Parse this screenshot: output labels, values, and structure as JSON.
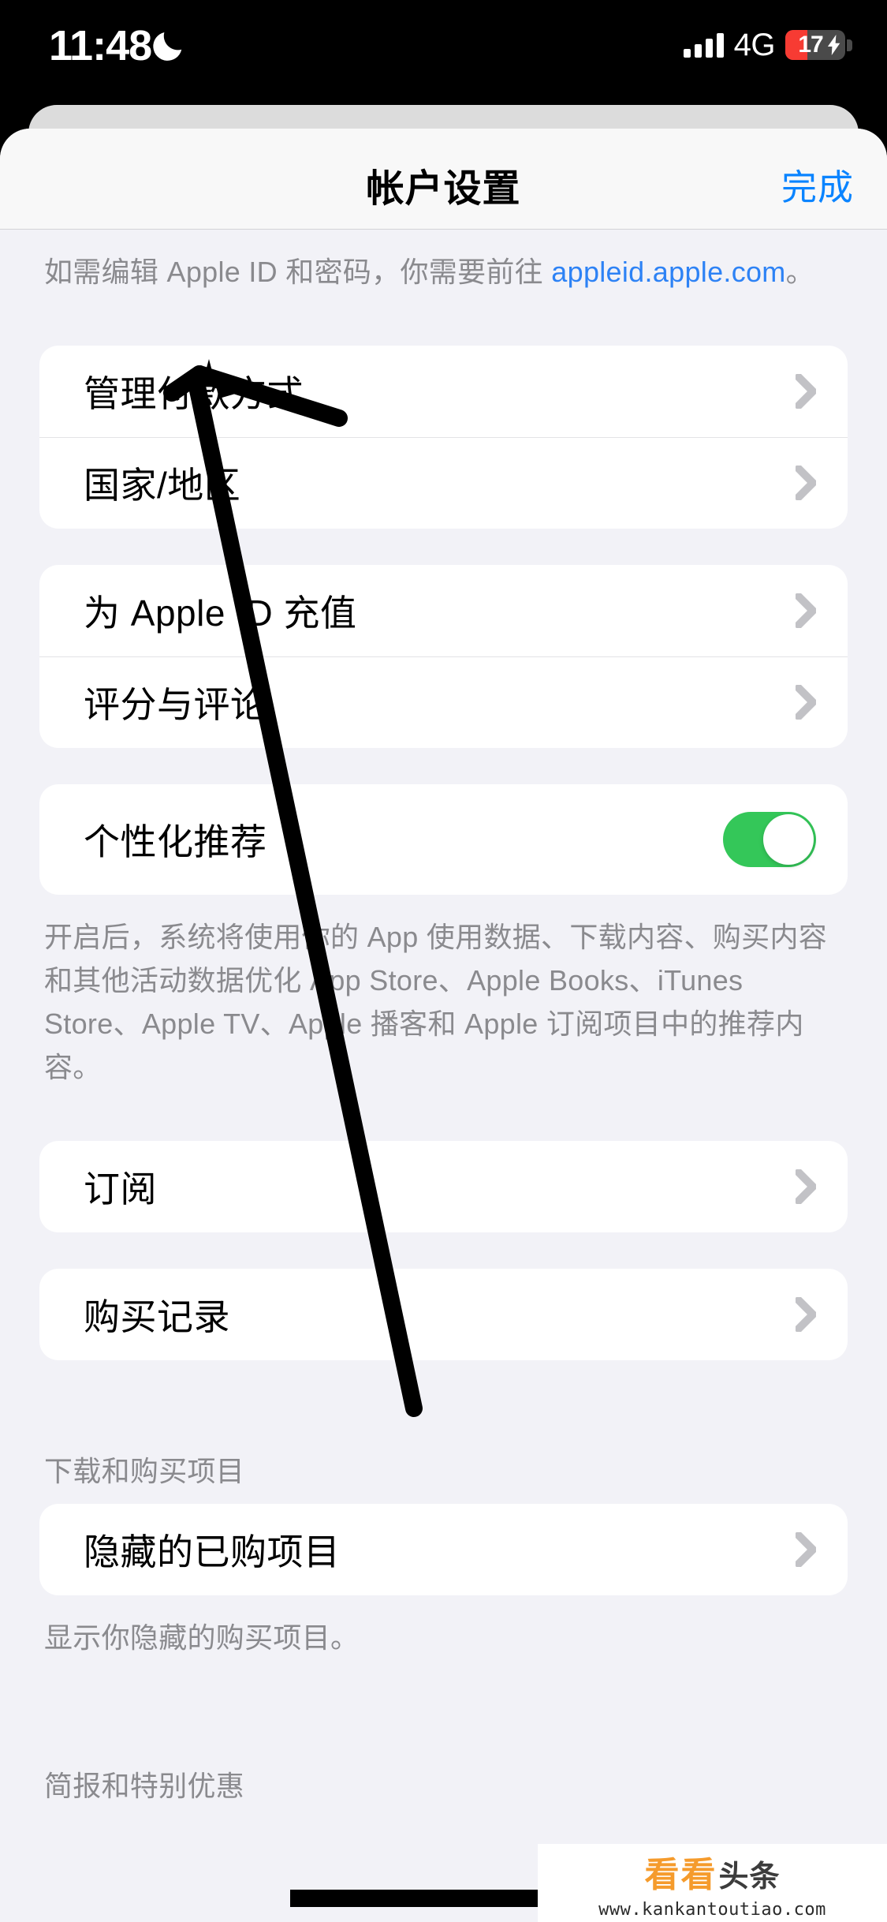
{
  "status_bar": {
    "time": "11:48",
    "moon_icon": "crescent-moon-icon",
    "signal_icon": "cellular-bars-icon",
    "signal_bars": 4,
    "network": "4G",
    "battery_percent": "17",
    "battery_level": 17,
    "battery_charging": true,
    "battery_color": "#F73B33"
  },
  "nav": {
    "title": "帐户设置",
    "done_label": "完成",
    "done_color": "#0A84FF"
  },
  "top_footnote": {
    "text_before": "如需编辑 Apple ID 和密码，你需要前往 ",
    "link": "appleid.apple.com",
    "text_after": "。"
  },
  "sections": [
    {
      "rows": [
        {
          "label": "管理付款方式",
          "accessory": "chevron"
        },
        {
          "label": "国家/地区",
          "accessory": "chevron"
        }
      ]
    },
    {
      "rows": [
        {
          "label": "为 Apple ID 充值",
          "accessory": "chevron"
        },
        {
          "label": "评分与评论",
          "accessory": "chevron"
        }
      ]
    },
    {
      "rows": [
        {
          "label": "个性化推荐",
          "accessory": "toggle",
          "toggle_on": true,
          "toggle_color": "#34C759"
        }
      ],
      "footnote": "开启后，系统将使用你的 App 使用数据、下载内容、购买内容和其他活动数据优化 App Store、Apple Books、iTunes Store、Apple TV、Apple 播客和 Apple 订阅项目中的推荐内容。"
    },
    {
      "rows": [
        {
          "label": "订阅",
          "accessory": "chevron"
        }
      ]
    },
    {
      "rows": [
        {
          "label": "购买记录",
          "accessory": "chevron"
        }
      ]
    },
    {
      "header": "下载和购买项目",
      "rows": [
        {
          "label": "隐藏的已购项目",
          "accessory": "chevron"
        }
      ],
      "footnote": "显示你隐藏的购买项目。"
    },
    {
      "header": "简报和特别优惠",
      "rows": []
    }
  ],
  "annotation": {
    "type": "arrow",
    "points_to": "国家/地区",
    "color": "#000000"
  },
  "watermark": {
    "logo_accent": "看看",
    "logo_text": "头条",
    "url": "www.kankantoutiao.com",
    "accent_color": "#F59B2C"
  }
}
